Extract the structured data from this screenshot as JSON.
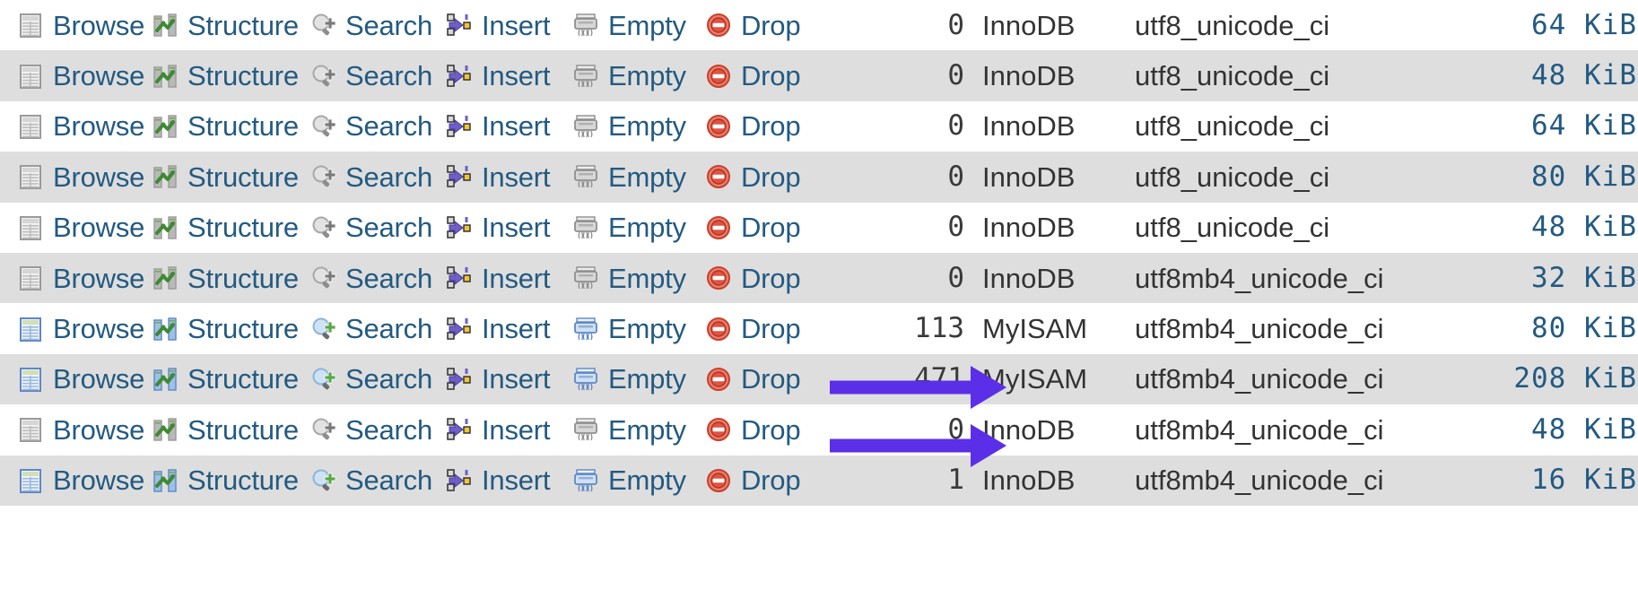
{
  "colors": {
    "link": "#235a81",
    "row_stripe": "#dedede",
    "row_plain": "#ffffff",
    "size_text": "#235a81",
    "annotation_arrow": "#5b2fe8",
    "text_dark": "#333333"
  },
  "actions": {
    "browse": "Browse",
    "structure": "Structure",
    "search": "Search",
    "insert": "Insert",
    "empty": "Empty",
    "drop": "Drop"
  },
  "icons": {
    "browse": "browse-table-icon",
    "structure": "structure-chart-icon",
    "search": "search-magnifier-icon",
    "insert": "insert-row-icon",
    "empty": "empty-shredder-icon",
    "drop": "drop-deny-icon"
  },
  "rows": [
    {
      "rows": "0",
      "engine": "InnoDB",
      "collation": "utf8_unicode_ci",
      "size": "64 KiB",
      "enabled": false,
      "arrow": false
    },
    {
      "rows": "0",
      "engine": "InnoDB",
      "collation": "utf8_unicode_ci",
      "size": "48 KiB",
      "enabled": false,
      "arrow": false
    },
    {
      "rows": "0",
      "engine": "InnoDB",
      "collation": "utf8_unicode_ci",
      "size": "64 KiB",
      "enabled": false,
      "arrow": false
    },
    {
      "rows": "0",
      "engine": "InnoDB",
      "collation": "utf8_unicode_ci",
      "size": "80 KiB",
      "enabled": false,
      "arrow": false
    },
    {
      "rows": "0",
      "engine": "InnoDB",
      "collation": "utf8_unicode_ci",
      "size": "48 KiB",
      "enabled": false,
      "arrow": false
    },
    {
      "rows": "0",
      "engine": "InnoDB",
      "collation": "utf8mb4_unicode_ci",
      "size": "32 KiB",
      "enabled": false,
      "arrow": false
    },
    {
      "rows": "113",
      "engine": "MyISAM",
      "collation": "utf8mb4_unicode_ci",
      "size": "80 KiB",
      "enabled": true,
      "arrow": true
    },
    {
      "rows": "471",
      "engine": "MyISAM",
      "collation": "utf8mb4_unicode_ci",
      "size": "208 KiB",
      "enabled": true,
      "arrow": true
    },
    {
      "rows": "0",
      "engine": "InnoDB",
      "collation": "utf8mb4_unicode_ci",
      "size": "48 KiB",
      "enabled": false,
      "arrow": false
    },
    {
      "rows": "1",
      "engine": "InnoDB",
      "collation": "utf8mb4_unicode_ci",
      "size": "16 KiB",
      "enabled": true,
      "arrow": false
    }
  ]
}
